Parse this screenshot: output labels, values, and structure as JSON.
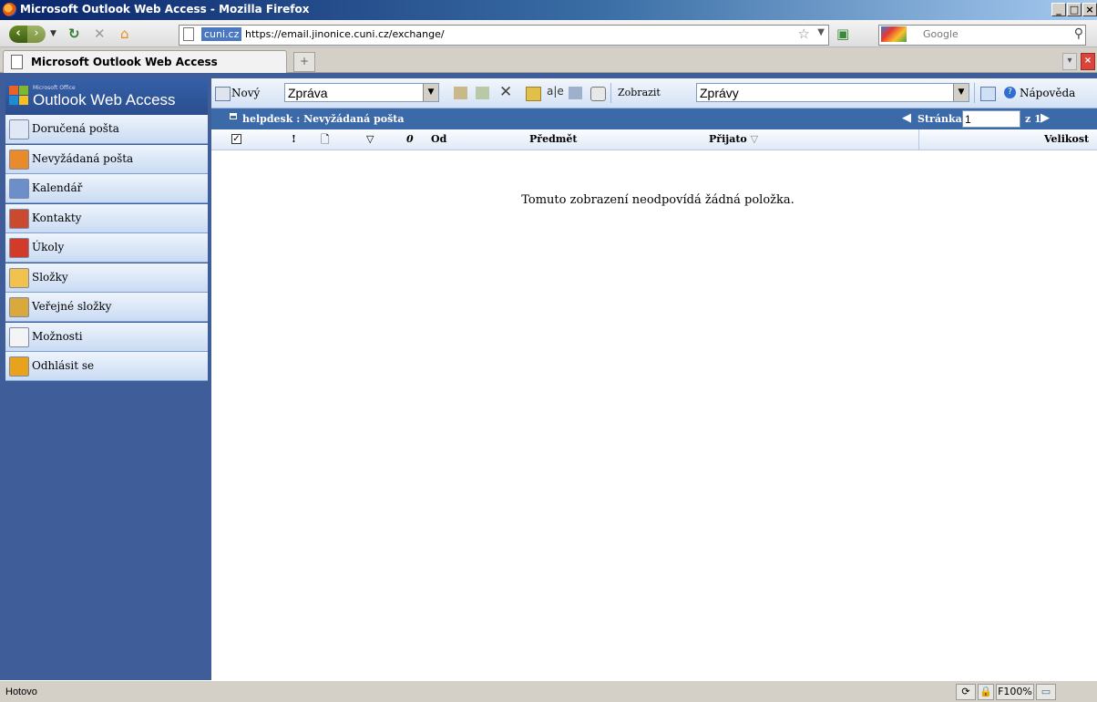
{
  "window": {
    "title": "Microsoft Outlook Web Access - Mozilla Firefox"
  },
  "browser": {
    "url_domain": "cuni.cz",
    "url": "https://email.jinonice.cuni.cz/exchange/",
    "search_placeholder": "Google",
    "tab_title": "Microsoft Outlook Web Access",
    "new_tab_glyph": "+"
  },
  "owa": {
    "logo_small": "Microsoft Office",
    "logo_text": "Outlook Web Access",
    "nav_items": [
      {
        "label": "Doručená pošta",
        "icon": "inbox-icon",
        "color": "#e0e8f5"
      },
      {
        "label": "Nevyžádaná pošta",
        "icon": "junk-mail-icon",
        "color": "#e98b2a"
      },
      {
        "label": "Kalendář",
        "icon": "calendar-icon",
        "color": "#6d8fc9"
      },
      {
        "label": "Kontakty",
        "icon": "contacts-icon",
        "color": "#c94a2f"
      },
      {
        "label": "Úkoly",
        "icon": "tasks-icon",
        "color": "#d23a2a"
      },
      {
        "label": "Složky",
        "icon": "folder-icon",
        "color": "#f1c24d"
      },
      {
        "label": "Veřejné složky",
        "icon": "public-folders-icon",
        "color": "#d9a93b"
      },
      {
        "label": "Možnosti",
        "icon": "options-icon",
        "color": "#f4f4f4"
      },
      {
        "label": "Odhlásit se",
        "icon": "logoff-icon",
        "color": "#e9a21b"
      }
    ],
    "toolbar": {
      "new_label": "Nový",
      "new_select": "Zpráva",
      "view_label": "Zobrazit",
      "view_select": "Zprávy",
      "help_label": "Nápověda"
    },
    "folder": {
      "path": "helpdesk : Nevyžádaná pošta",
      "page_label": "Stránka:",
      "page_value": "1",
      "page_of": "z 1"
    },
    "columns": {
      "importance": "!",
      "type": "🗋",
      "flag": "▽",
      "attachment": "0",
      "from": "Od",
      "subject": "Předmět",
      "received": "Přijato",
      "size": "Velikost"
    },
    "empty_message": "Tomuto zobrazení neodpovídá žádná položka."
  },
  "status": {
    "text": "Hotovo",
    "zoom": "F100%"
  }
}
